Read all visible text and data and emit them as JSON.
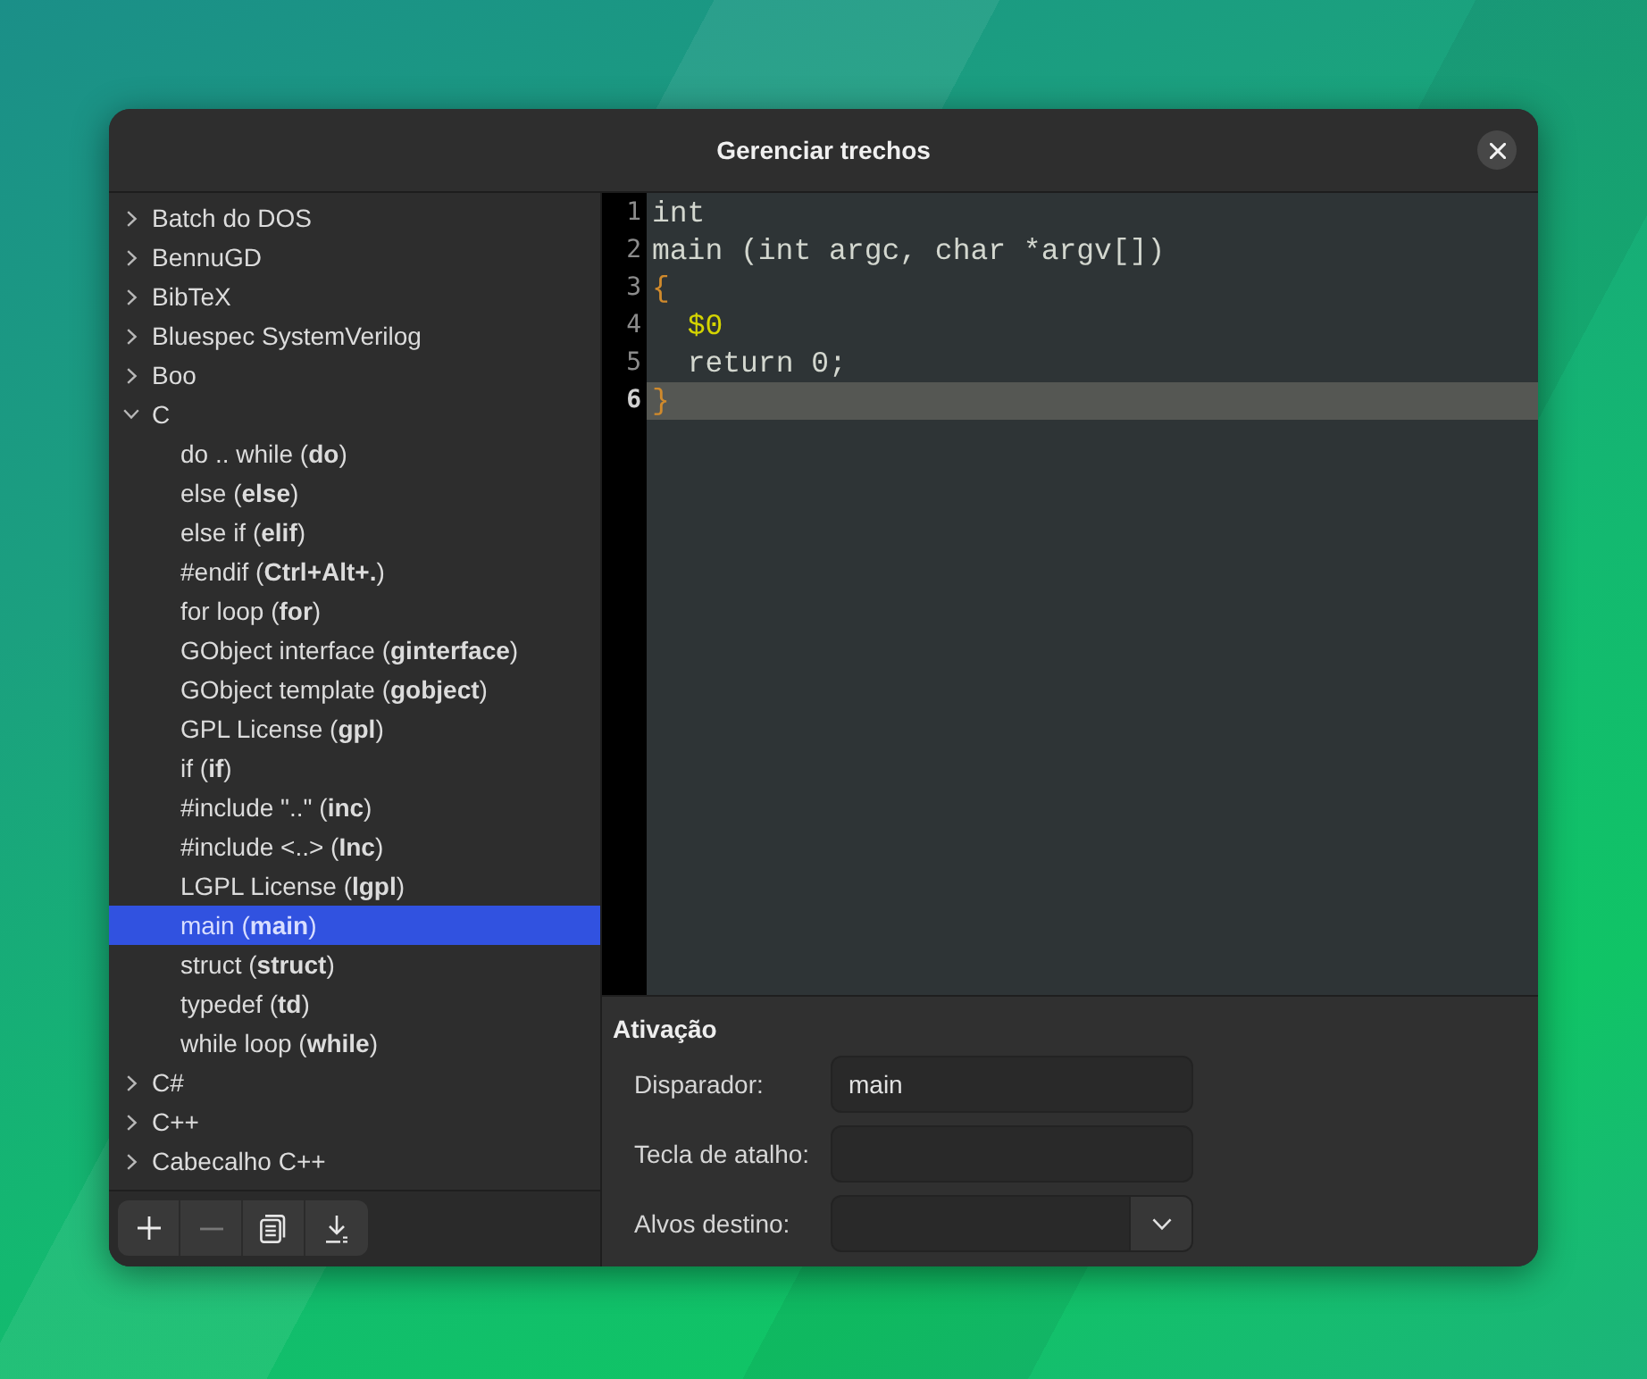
{
  "window": {
    "title": "Gerenciar trechos"
  },
  "snippet_tree": {
    "items": [
      {
        "label": "Batch do DOS",
        "expanded": false,
        "selected": false
      },
      {
        "label": "BennuGD",
        "expanded": false,
        "selected": false
      },
      {
        "label": "BibTeX",
        "expanded": false,
        "selected": false
      },
      {
        "label": "Bluespec SystemVerilog",
        "expanded": false,
        "selected": false
      },
      {
        "label": "Boo",
        "expanded": false,
        "selected": false
      },
      {
        "label": "C",
        "expanded": true,
        "selected": false,
        "children": [
          {
            "label": "do .. while (**do**)",
            "selected": false
          },
          {
            "label": "else (**else**)",
            "selected": false
          },
          {
            "label": "else if (**elif**)",
            "selected": false
          },
          {
            "label": "#endif (**Ctrl+Alt+.**)",
            "selected": false
          },
          {
            "label": "for loop (**for**)",
            "selected": false
          },
          {
            "label": "GObject interface (**ginterface**)",
            "selected": false
          },
          {
            "label": "GObject template (**gobject**)",
            "selected": false
          },
          {
            "label": "GPL License (**gpl**)",
            "selected": false
          },
          {
            "label": "if (**if**)",
            "selected": false
          },
          {
            "label": "#include \"..\" (**inc**)",
            "selected": false
          },
          {
            "label": "#include <..> (**Inc**)",
            "selected": false
          },
          {
            "label": "LGPL License (**lgpl**)",
            "selected": false
          },
          {
            "label": "main (**main**)",
            "selected": true
          },
          {
            "label": "struct (**struct**)",
            "selected": false
          },
          {
            "label": "typedef (**td**)",
            "selected": false
          },
          {
            "label": "while loop (**while**)",
            "selected": false
          }
        ]
      },
      {
        "label": "C#",
        "expanded": false,
        "selected": false
      },
      {
        "label": "C++",
        "expanded": false,
        "selected": false
      },
      {
        "label": "Cabecalho C++",
        "expanded": false,
        "selected": false
      }
    ]
  },
  "toolbar": {
    "buttons": [
      {
        "kind": "add",
        "disabled": false
      },
      {
        "kind": "remove",
        "disabled": true
      },
      {
        "kind": "import",
        "disabled": false
      },
      {
        "kind": "export",
        "disabled": false
      }
    ]
  },
  "editor": {
    "lines": [
      {
        "number": "1",
        "current": false,
        "segments": [
          {
            "kind": "plain",
            "text": "int"
          }
        ]
      },
      {
        "number": "2",
        "current": false,
        "segments": [
          {
            "kind": "plain",
            "text": "main (int argc, char *argv[])"
          }
        ]
      },
      {
        "number": "3",
        "current": false,
        "segments": [
          {
            "kind": "brace",
            "text": "{"
          }
        ]
      },
      {
        "number": "4",
        "current": false,
        "segments": [
          {
            "kind": "placeholder",
            "text": "  $0"
          }
        ]
      },
      {
        "number": "5",
        "current": false,
        "segments": [
          {
            "kind": "plain",
            "text": "  return 0;"
          }
        ]
      },
      {
        "number": "6",
        "current": true,
        "segments": [
          {
            "kind": "brace",
            "text": "}"
          }
        ]
      }
    ]
  },
  "activation": {
    "heading": "Ativação",
    "fields": [
      {
        "kind": "entry",
        "label": "Disparador:",
        "value": "main"
      },
      {
        "kind": "entry",
        "label": "Tecla de atalho:"
      },
      {
        "kind": "combo",
        "label": "Alvos destino:"
      }
    ]
  }
}
